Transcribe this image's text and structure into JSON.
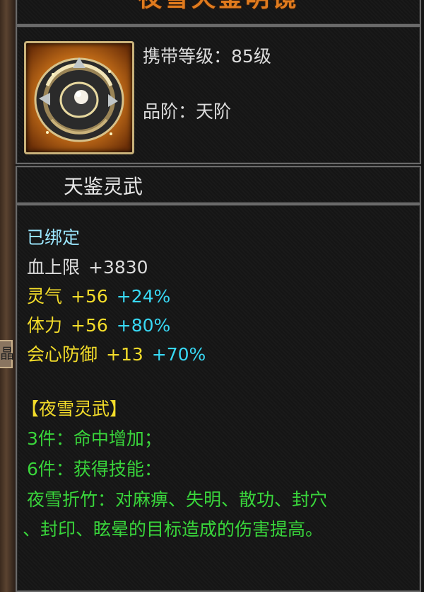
{
  "item": {
    "title": "夜雪天鉴明镜",
    "carry_level_label": "携带等级：",
    "carry_level_value": "85级",
    "grade_label": "品阶：",
    "grade_value": "天阶",
    "subname": "天鉴灵武",
    "bind_status": "已绑定"
  },
  "stats": [
    {
      "name": "血上限",
      "value": "+3830",
      "bonus": ""
    },
    {
      "name": "灵气",
      "value": "+56",
      "bonus": "+24%"
    },
    {
      "name": "体力",
      "value": "+56",
      "bonus": "+80%"
    },
    {
      "name": "会心防御",
      "value": "+13",
      "bonus": "+70%"
    }
  ],
  "set": {
    "name": "【夜雪灵武】",
    "bonus_3": "3件：命中增加；",
    "bonus_6": "6件：获得技能：",
    "skill_line1": "夜雪折竹：对麻痹、失明、散功、封穴",
    "skill_line2": "、封印、眩晕的目标造成的伤害提高。"
  },
  "colors": {
    "title": "#e07b1e",
    "white_text": "#dcdcdc",
    "bind": "#9be7ff",
    "stat_yellow": "#f3dc2a",
    "stat_bonus": "#38d9f5",
    "set_green": "#39d53b"
  },
  "icons": {
    "item_icon": "mirror-disc-icon",
    "side_notch": "晶"
  }
}
